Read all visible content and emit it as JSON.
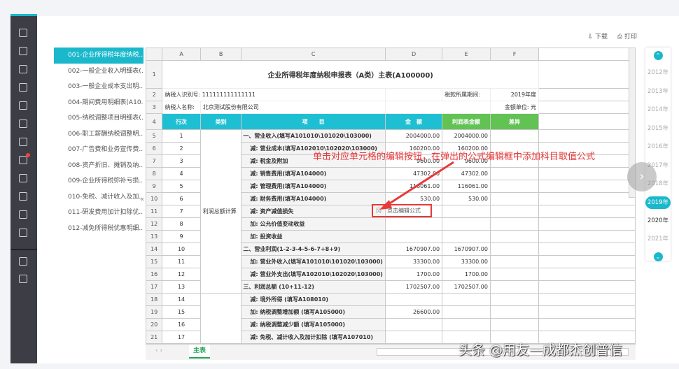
{
  "toolbar": {
    "download": "下载",
    "print": "打印"
  },
  "left_list": [
    "001-企业所得税年度纳税...",
    "002-一般企业收入明细表(...",
    "003-一般企业成本支出明...",
    "004-期间费用明细表(A10...",
    "005-纳税调整项目明细表(...",
    "006-职工薪酬纳税调整明...",
    "007-广告费和业务宣传费...",
    "008-资产折旧、摊销及纳...",
    "009-企业所得税弥补亏损...",
    "010-免税、减计收入及加...",
    "011-研发费用加计扣除优...",
    "012-减免所得税优惠明细..."
  ],
  "columns": [
    "A",
    "B",
    "C",
    "D",
    "E",
    "F"
  ],
  "sheet": {
    "title": "企业所得税年度纳税申报表（A类）主表(A100000)",
    "taxpayer_id_label": "纳税人识别号: 111111111111111",
    "period_label": "税款所属期间:",
    "period_value": "2019年度",
    "taxpayer_name_label": "纳税人名称:",
    "taxpayer_name": "北京测试股份有限公司",
    "unit_label": "金额单位: 元",
    "headers": [
      "行次",
      "类别",
      "项　　目",
      "金　额",
      "利润表金额",
      "差异"
    ],
    "category": "利润总额计算",
    "rows": [
      {
        "n": "1",
        "item": "一、营业收入(填写A101010\\101020\\103000)",
        "d": "2004000.00",
        "e": "2004000.00",
        "indent": false
      },
      {
        "n": "2",
        "item": "减: 营业成本(填写A102010\\102020\\103000)",
        "d": "160200.00",
        "e": "160200.00",
        "indent": true
      },
      {
        "n": "3",
        "item": "减: 税金及附加",
        "d": "9600.00",
        "e": "9600.00",
        "indent": true
      },
      {
        "n": "4",
        "item": "减: 销售费用(填写A104000)",
        "d": "47302.00",
        "e": "47302.00",
        "indent": true
      },
      {
        "n": "5",
        "item": "减: 管理费用(填写A104000)",
        "d": "116061.00",
        "e": "116061.00",
        "indent": true
      },
      {
        "n": "6",
        "item": "减: 财务费用(填写A104000)",
        "d": "530.00",
        "e": "530.00",
        "indent": true
      },
      {
        "n": "7",
        "item": "减: 资产减值损失",
        "d": "",
        "e": "",
        "indent": true
      },
      {
        "n": "8",
        "item": "加: 公允价值变动收益",
        "d": "",
        "e": "",
        "indent": true
      },
      {
        "n": "9",
        "item": "加: 投资收益",
        "d": "",
        "e": "",
        "indent": true
      },
      {
        "n": "10",
        "item": "二、营业利润(1-2-3-4-5-6-7+8+9)",
        "d": "1670907.00",
        "e": "1670907.00",
        "indent": false
      },
      {
        "n": "11",
        "item": "加: 营业外收入(填写A101010\\101020\\103000)",
        "d": "33300.00",
        "e": "33300.00",
        "indent": true
      },
      {
        "n": "12",
        "item": "减: 营业外支出(填写A102010\\102020\\103000)",
        "d": "1700.00",
        "e": "1700.00",
        "indent": true
      },
      {
        "n": "13",
        "item": "三、利润总额 (10+11-12)",
        "d": "1702507.00",
        "e": "1702507.00",
        "indent": false
      },
      {
        "n": "14",
        "item": "减: 境外所得 (填写A108010)",
        "d": "",
        "e": "",
        "indent": true
      },
      {
        "n": "15",
        "item": "加: 纳税调整增加额 (填写A105000)",
        "d": "26600.00",
        "e": "",
        "indent": true
      },
      {
        "n": "16",
        "item": "减: 纳税调整减少额 (填写A105000)",
        "d": "",
        "e": "",
        "indent": true
      },
      {
        "n": "17",
        "item": "减: 免税、减计收入及加计扣除 (填写A107010)",
        "d": "",
        "e": "",
        "indent": true
      }
    ]
  },
  "edit_cell": {
    "icon_text": "冈",
    "label": "点击编辑公式"
  },
  "sheet_tab": "主表",
  "years": [
    "2012年",
    "2013年",
    "2014年",
    "2015年",
    "2016年",
    "2017年",
    "2018年",
    "2019年",
    "2020年",
    "2021年"
  ],
  "selected_year": "2019年",
  "annotation": "单击对应单元格的编辑按钮，在弹出的公式编辑框中添加科目取值公式",
  "watermark": "头条 @用友—成都杰创普信",
  "colors": {
    "accent": "#1bb8cb",
    "green": "#62c254",
    "annotation": "#e8393a",
    "sidebar": "#3d3d46"
  }
}
